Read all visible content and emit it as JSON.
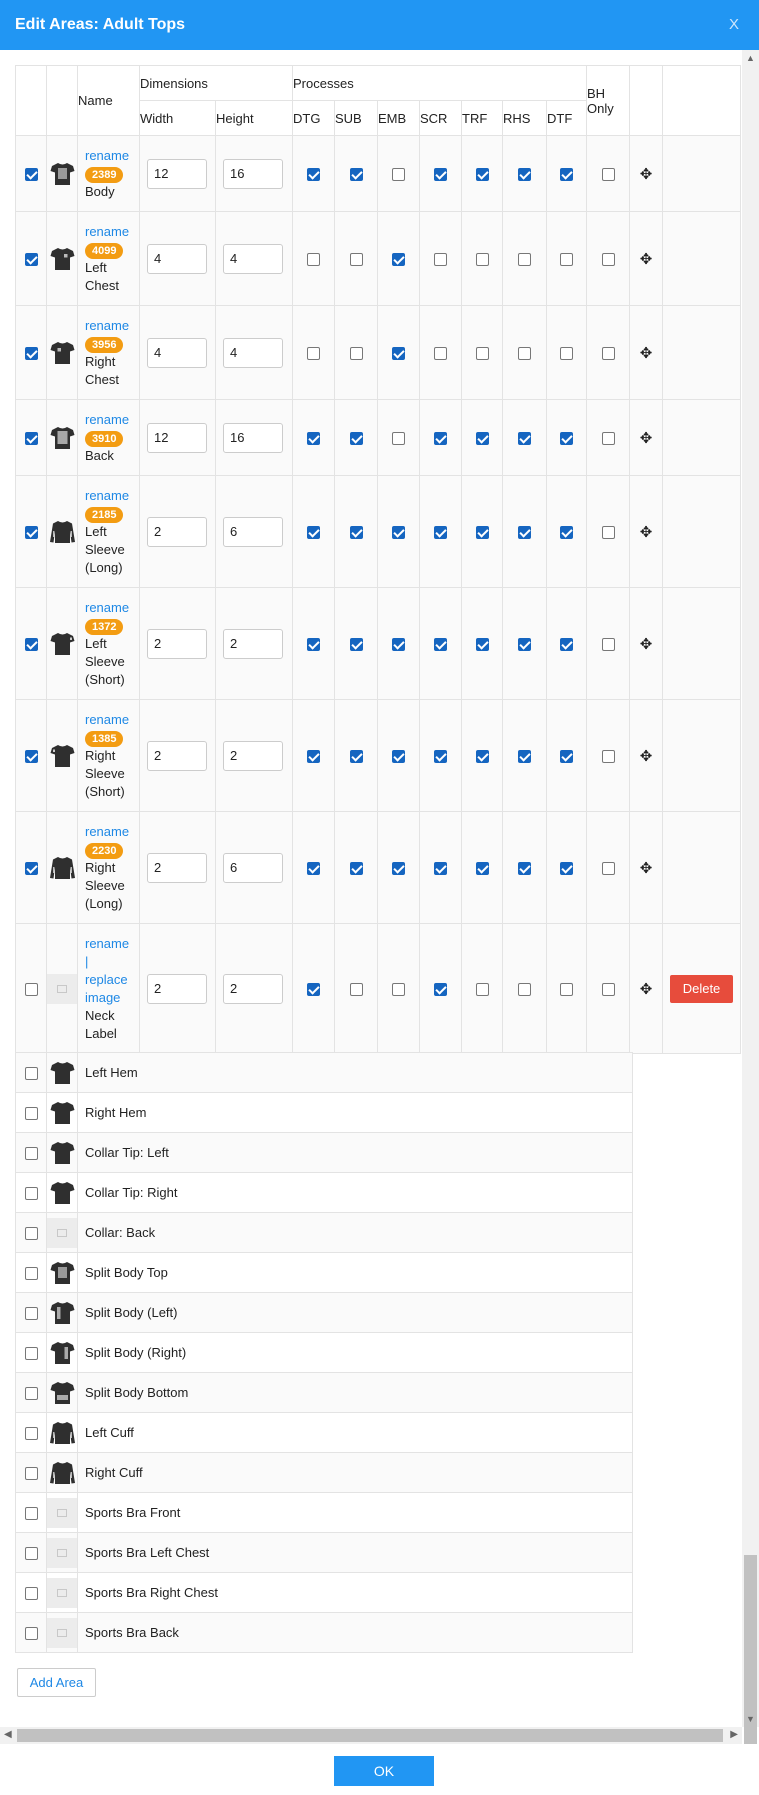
{
  "dialog": {
    "title": "Edit Areas: Adult Tops",
    "close_label": "X"
  },
  "headers": {
    "name": "Name",
    "dimensions": "Dimensions",
    "processes": "Processes",
    "bh_only": "BH Only",
    "width": "Width",
    "height": "Height",
    "process_codes": [
      "DTG",
      "SUB",
      "EMB",
      "SCR",
      "TRF",
      "RHS",
      "DTF"
    ]
  },
  "labels": {
    "rename": "rename",
    "replace_image": "replace image",
    "separator": "|",
    "delete": "Delete"
  },
  "areas": [
    {
      "selected": true,
      "thumb": "body",
      "badge": "2389",
      "name": "Body",
      "width": "12",
      "height": "16",
      "processes": [
        true,
        true,
        false,
        true,
        true,
        true,
        true
      ],
      "bh_only": false
    },
    {
      "selected": true,
      "thumb": "left-chest",
      "badge": "4099",
      "name": "Left Chest",
      "width": "4",
      "height": "4",
      "processes": [
        false,
        false,
        true,
        false,
        false,
        false,
        false
      ],
      "bh_only": false
    },
    {
      "selected": true,
      "thumb": "right-chest",
      "badge": "3956",
      "name": "Right Chest",
      "width": "4",
      "height": "4",
      "processes": [
        false,
        false,
        true,
        false,
        false,
        false,
        false
      ],
      "bh_only": false
    },
    {
      "selected": true,
      "thumb": "back",
      "badge": "3910",
      "name": "Back",
      "width": "12",
      "height": "16",
      "processes": [
        true,
        true,
        false,
        true,
        true,
        true,
        true
      ],
      "bh_only": false
    },
    {
      "selected": true,
      "thumb": "long",
      "badge": "2185",
      "name": "Left Sleeve (Long)",
      "width": "2",
      "height": "6",
      "processes": [
        true,
        true,
        true,
        true,
        true,
        true,
        true
      ],
      "bh_only": false
    },
    {
      "selected": true,
      "thumb": "left-sleeve",
      "badge": "1372",
      "name": "Left Sleeve (Short)",
      "width": "2",
      "height": "2",
      "processes": [
        true,
        true,
        true,
        true,
        true,
        true,
        true
      ],
      "bh_only": false
    },
    {
      "selected": true,
      "thumb": "right-sleeve",
      "badge": "1385",
      "name": "Right Sleeve (Short)",
      "width": "2",
      "height": "2",
      "processes": [
        true,
        true,
        true,
        true,
        true,
        true,
        true
      ],
      "bh_only": false
    },
    {
      "selected": true,
      "thumb": "long",
      "badge": "2230",
      "name": "Right Sleeve (Long)",
      "width": "2",
      "height": "6",
      "processes": [
        true,
        true,
        true,
        true,
        true,
        true,
        true
      ],
      "bh_only": false
    },
    {
      "selected": false,
      "thumb": "placeholder",
      "badge": null,
      "name": "Neck Label",
      "width": "2",
      "height": "2",
      "processes": [
        true,
        false,
        false,
        true,
        false,
        false,
        false
      ],
      "bh_only": false,
      "custom": true
    }
  ],
  "available_areas": [
    {
      "name": "Left Hem",
      "thumb": "plain"
    },
    {
      "name": "Right Hem",
      "thumb": "plain"
    },
    {
      "name": "Collar Tip: Left",
      "thumb": "plain"
    },
    {
      "name": "Collar Tip: Right",
      "thumb": "plain"
    },
    {
      "name": "Collar: Back",
      "thumb": "placeholder"
    },
    {
      "name": "Split Body Top",
      "thumb": "body"
    },
    {
      "name": "Split Body (Left)",
      "thumb": "split-left"
    },
    {
      "name": "Split Body (Right)",
      "thumb": "split-right"
    },
    {
      "name": "Split Body Bottom",
      "thumb": "split-bottom"
    },
    {
      "name": "Left Cuff",
      "thumb": "long"
    },
    {
      "name": "Right Cuff",
      "thumb": "long"
    },
    {
      "name": "Sports Bra Front",
      "thumb": "placeholder"
    },
    {
      "name": "Sports Bra Left Chest",
      "thumb": "placeholder"
    },
    {
      "name": "Sports Bra Right Chest",
      "thumb": "placeholder"
    },
    {
      "name": "Sports Bra Back",
      "thumb": "placeholder"
    }
  ],
  "buttons": {
    "add_area": "Add Area",
    "ok": "OK"
  }
}
